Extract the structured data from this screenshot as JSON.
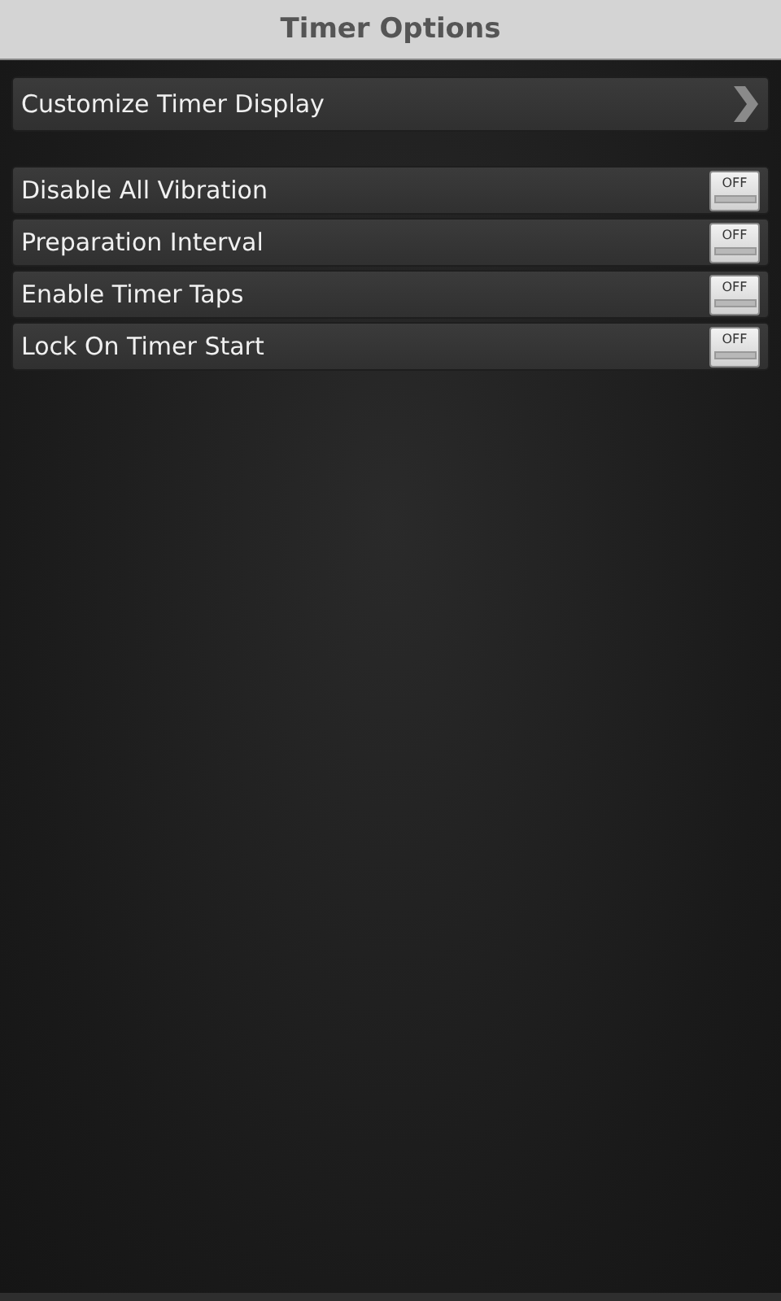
{
  "title_bar": {
    "title": "Timer Options"
  },
  "nav_item": {
    "label": "Customize Timer Display"
  },
  "settings": [
    {
      "label": "Disable All Vibration",
      "toggle_text": "OFF",
      "on": false
    },
    {
      "label": "Preparation Interval",
      "toggle_text": "OFF",
      "on": false
    },
    {
      "label": "Enable Timer Taps",
      "toggle_text": "OFF",
      "on": false
    },
    {
      "label": "Lock On Timer Start",
      "toggle_text": "OFF",
      "on": false
    }
  ]
}
